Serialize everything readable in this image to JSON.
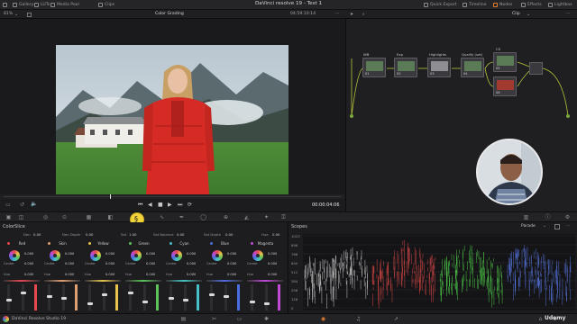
{
  "topbar": {
    "left_items": [
      {
        "icon": "gallery-icon",
        "label": "Gallery"
      },
      {
        "icon": "luts-icon",
        "label": "LUTs"
      },
      {
        "icon": "media-pool-icon",
        "label": "Media Pool"
      },
      {
        "icon": "clips-icon",
        "label": "Clips"
      }
    ],
    "title": "DaVinci resolve 19 - Test 1",
    "right_items": [
      {
        "icon": "quick-export-icon",
        "label": "Quick Export"
      },
      {
        "icon": "timeline-icon",
        "label": "Timeline"
      },
      {
        "icon": "nodes-icon",
        "label": "Nodes",
        "active": true
      },
      {
        "icon": "effects-icon",
        "label": "Effects"
      },
      {
        "icon": "lightbox-icon",
        "label": "Lightbox"
      }
    ]
  },
  "subbar": {
    "zoom": "81%",
    "page": "Color Grading",
    "timecode": "04:59:10:14",
    "clip_menu": "Clip"
  },
  "viewer": {
    "current_time": "00:00:04:06"
  },
  "nodes": [
    {
      "label": "WB",
      "number": "01"
    },
    {
      "label": "Exp",
      "number": "02"
    },
    {
      "label": "Highlights",
      "number": "03"
    },
    {
      "label": "Qualify (set)",
      "number": "04"
    },
    {
      "label": "CS",
      "number": "05"
    },
    {
      "label": "",
      "number": "06"
    }
  ],
  "colorslice": {
    "title": "ColorSlice",
    "params": [
      {
        "label": "Den",
        "value": "0.00"
      },
      {
        "label": "Den Depth",
        "value": "0.00"
      },
      {
        "label": "Sat",
        "value": "1.00"
      },
      {
        "label": "Sat Balance",
        "value": "0.00"
      },
      {
        "label": "Sat Depth",
        "value": "0.00"
      },
      {
        "label": "Hue",
        "value": "0.00"
      }
    ],
    "columns": [
      {
        "name": "Red",
        "color": "#e5484d",
        "value": "0.000",
        "center": "0.000",
        "hue": "0.000"
      },
      {
        "name": "Skin",
        "color": "#e0a070",
        "value": "0.000",
        "center": "0.000",
        "hue": "0.000"
      },
      {
        "name": "Yellow",
        "color": "#e8c44a",
        "value": "0.000",
        "center": "0.000",
        "hue": "0.000"
      },
      {
        "name": "Green",
        "color": "#5ec45a",
        "value": "0.000",
        "center": "0.000",
        "hue": "0.000"
      },
      {
        "name": "Cyan",
        "color": "#46c1c8",
        "value": "0.000",
        "center": "0.000",
        "hue": "0.000"
      },
      {
        "name": "Blue",
        "color": "#4b6ee0",
        "value": "0.000",
        "center": "0.000",
        "hue": "0.000"
      },
      {
        "name": "Magenta",
        "color": "#c04ad6",
        "value": "0.000",
        "center": "0.000",
        "hue": "0.000"
      }
    ],
    "center_label": "Center",
    "hue_label": "Hue"
  },
  "scopes": {
    "title": "Scopes",
    "mode": "Parade",
    "scale": [
      "1023",
      "896",
      "768",
      "640",
      "512",
      "384",
      "256",
      "128",
      "0"
    ]
  },
  "bottombar": {
    "app": "DaVinci Resolve Studio 19"
  },
  "watermark": "Udemy"
}
